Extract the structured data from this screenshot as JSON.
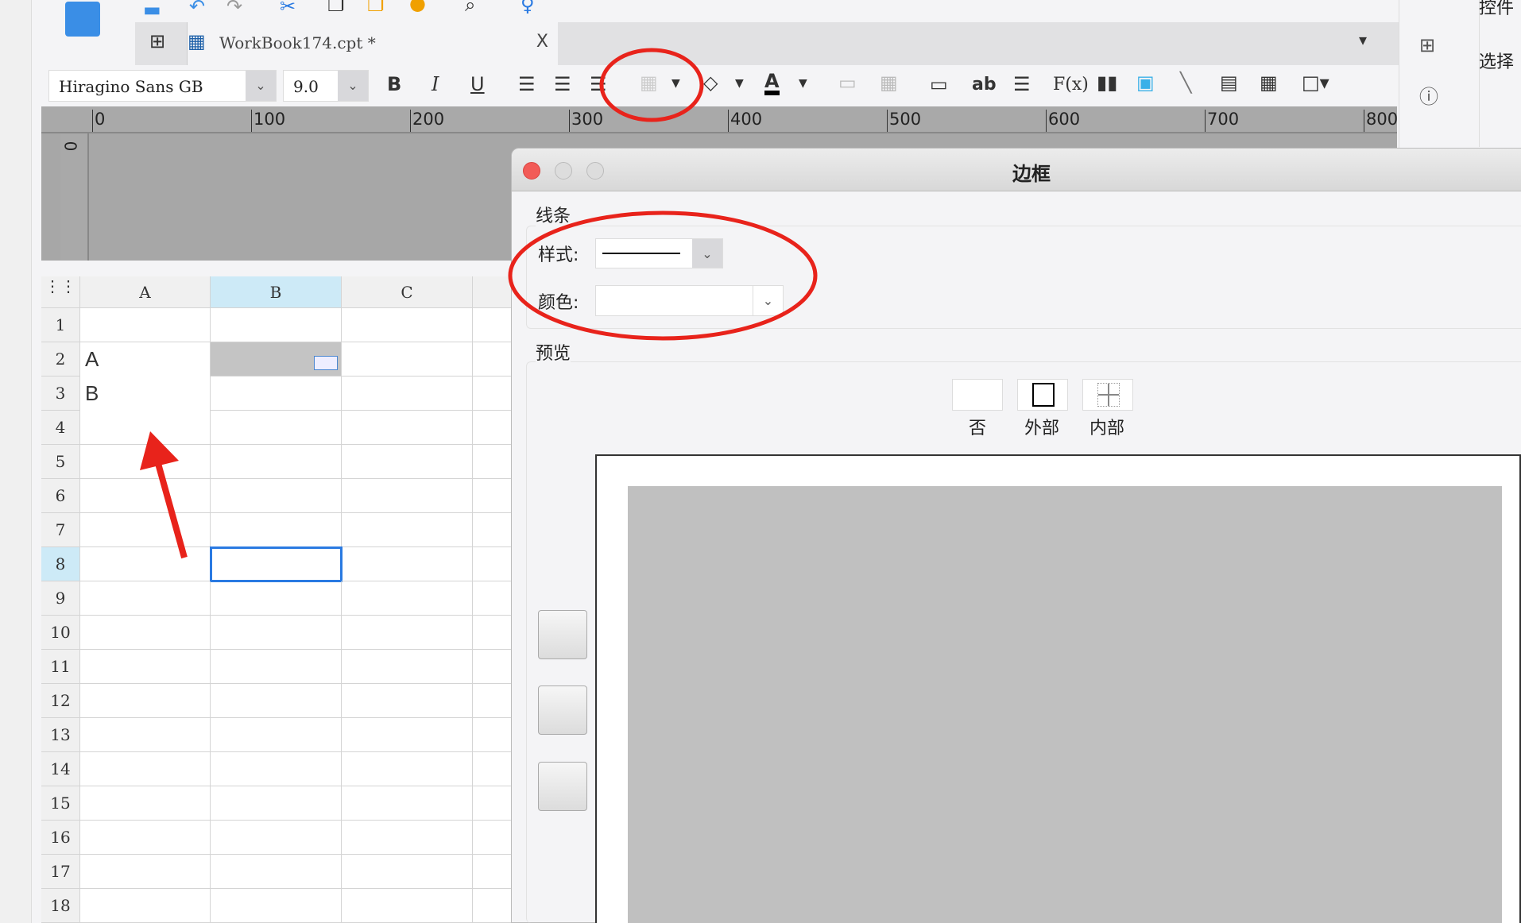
{
  "tab": {
    "title": "WorkBook174.cpt *",
    "close": "X"
  },
  "format": {
    "font": "Hiragino Sans GB",
    "size": "9.0",
    "bold": "B",
    "italic": "I",
    "underline": "U",
    "text_ab": "ab",
    "formula": "F(x)"
  },
  "ruler": [
    "0",
    "100",
    "200",
    "300",
    "400",
    "500",
    "600",
    "700",
    "800"
  ],
  "vruler": "0",
  "sheet": {
    "columns": [
      "A",
      "B",
      "C"
    ],
    "rows": [
      "1",
      "2",
      "3",
      "4",
      "5",
      "6",
      "7",
      "8",
      "9",
      "10",
      "11",
      "12",
      "13",
      "14",
      "15",
      "16",
      "17",
      "18"
    ],
    "cells": {
      "A2": "A",
      "A3": "B"
    },
    "selected": "B8"
  },
  "right_panel": {
    "top_label": "控件",
    "select_label": "选择"
  },
  "dialog": {
    "title": "边框",
    "line_group": "线条",
    "style_label": "样式:",
    "color_label": "颜色:",
    "preview_group": "预览",
    "presets": [
      "否",
      "外部",
      "内部"
    ]
  },
  "colors": {
    "accent": "#2a7ae2",
    "annotation": "#e8231b",
    "selected_col": "#cdeaf7"
  }
}
